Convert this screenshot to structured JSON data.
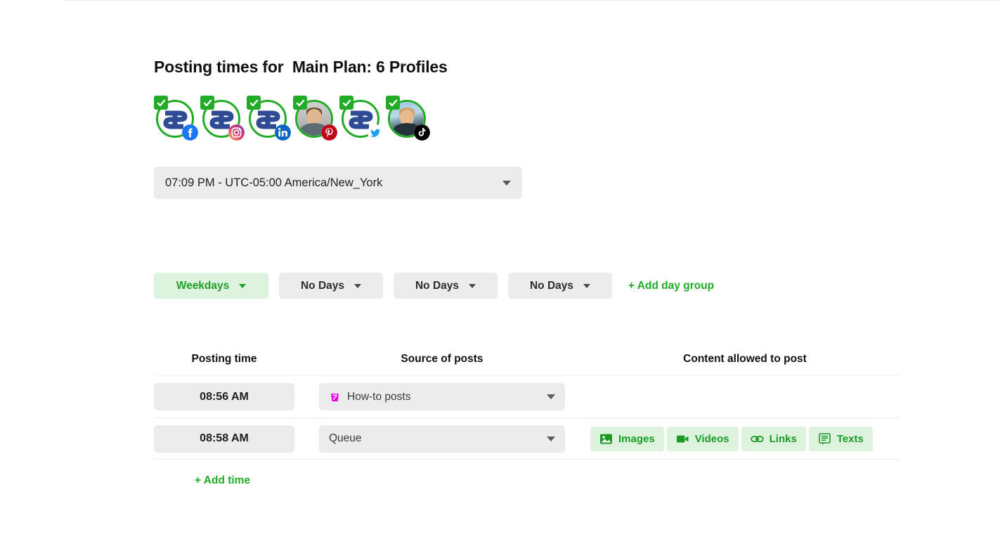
{
  "page": {
    "title": "Posting times for  Main Plan: 6 Profiles"
  },
  "profiles": [
    {
      "name": "facebook-profile",
      "network": "facebook",
      "avatar_type": "logo",
      "selected": true
    },
    {
      "name": "instagram-profile",
      "network": "instagram",
      "avatar_type": "logo",
      "selected": true
    },
    {
      "name": "linkedin-profile",
      "network": "linkedin",
      "avatar_type": "logo",
      "selected": true
    },
    {
      "name": "pinterest-profile",
      "network": "pinterest",
      "avatar_type": "photo",
      "selected": true
    },
    {
      "name": "twitter-profile",
      "network": "twitter",
      "avatar_type": "logo",
      "selected": true
    },
    {
      "name": "tiktok-profile",
      "network": "tiktok",
      "avatar_type": "photo",
      "selected": true
    }
  ],
  "timezone": {
    "value": "07:09 PM - UTC-05:00 America/New_York",
    "icon": "chevron-down-icon"
  },
  "day_groups": [
    {
      "label": "Weekdays",
      "active": true
    },
    {
      "label": "No Days",
      "active": false
    },
    {
      "label": "No Days",
      "active": false
    },
    {
      "label": "No Days",
      "active": false
    }
  ],
  "add_day_group_label": "+ Add day group",
  "table": {
    "headers": {
      "time": "Posting time",
      "source": "Source of posts",
      "content": "Content allowed to post"
    },
    "rows": [
      {
        "time": "08:56 AM",
        "source": "How-to posts",
        "source_has_icon": true,
        "source_icon_color": "#ee00ee",
        "content": []
      },
      {
        "time": "08:58 AM",
        "source": "Queue",
        "source_has_icon": false,
        "content": [
          {
            "label": "Images",
            "icon": "image-icon"
          },
          {
            "label": "Videos",
            "icon": "video-icon"
          },
          {
            "label": "Links",
            "icon": "link-icon"
          },
          {
            "label": "Texts",
            "icon": "text-icon"
          }
        ]
      }
    ]
  },
  "add_time_label": "+ Add time",
  "colors": {
    "accent_green": "#22ab27",
    "chip_bg": "#ddf3dd",
    "field_bg": "#ececec",
    "magenta": "#ee00ee"
  }
}
